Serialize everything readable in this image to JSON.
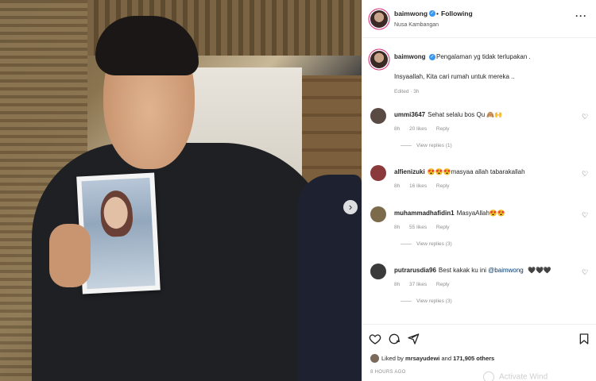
{
  "post": {
    "username": "baimwong",
    "follow_label": "Following",
    "location": "Nusa Kambangan",
    "caption_line1": "Pengalaman yg tidak terlupakan .",
    "caption_line2": "Insyaallah, Kita cari rumah untuk mereka ..",
    "caption_meta": "Edited · 3h"
  },
  "comments": [
    {
      "username": "ummi3647",
      "text": "Sehat selalu bos Qu 🙈🙌",
      "time": "8h",
      "likes": "20 likes",
      "reply": "Reply",
      "view_replies": "View replies (1)",
      "avatar_color": "#5a4a44"
    },
    {
      "username": "alfienizuki",
      "text": "😍😍😍masyaa allah tabarakallah",
      "time": "8h",
      "likes": "16 likes",
      "reply": "Reply",
      "view_replies": "",
      "avatar_color": "#8a3a3a"
    },
    {
      "username": "muhammadhafidin1",
      "text": "MasyaAllah😍😍",
      "time": "8h",
      "likes": "55 likes",
      "reply": "Reply",
      "view_replies": "View replies (3)",
      "avatar_color": "#7b6b4a"
    },
    {
      "username": "putrarusdia96",
      "text": "Best kakak ku ini",
      "mention": "@baimwong",
      "text_after": "🖤🖤🖤",
      "time": "8h",
      "likes": "37 likes",
      "reply": "Reply",
      "view_replies": "View replies (3)",
      "avatar_color": "#3a3a3a"
    }
  ],
  "likes": {
    "prefix": "Liked by",
    "user": "mrsayudewi",
    "middle": "and",
    "count": "171,905 others"
  },
  "time_ago": "8 HOURS AGO",
  "watermark": "Activate Wind",
  "icons": {
    "verified": "verified-badge-icon",
    "more": "more-options-icon",
    "like": "heart-icon",
    "comment": "comment-icon",
    "share": "share-icon",
    "save": "bookmark-icon",
    "next": "chevron-right-icon"
  },
  "colors": {
    "verified": "#3897f0",
    "muted": "#8e8e8e",
    "text": "#262626",
    "mention": "#00376b"
  }
}
